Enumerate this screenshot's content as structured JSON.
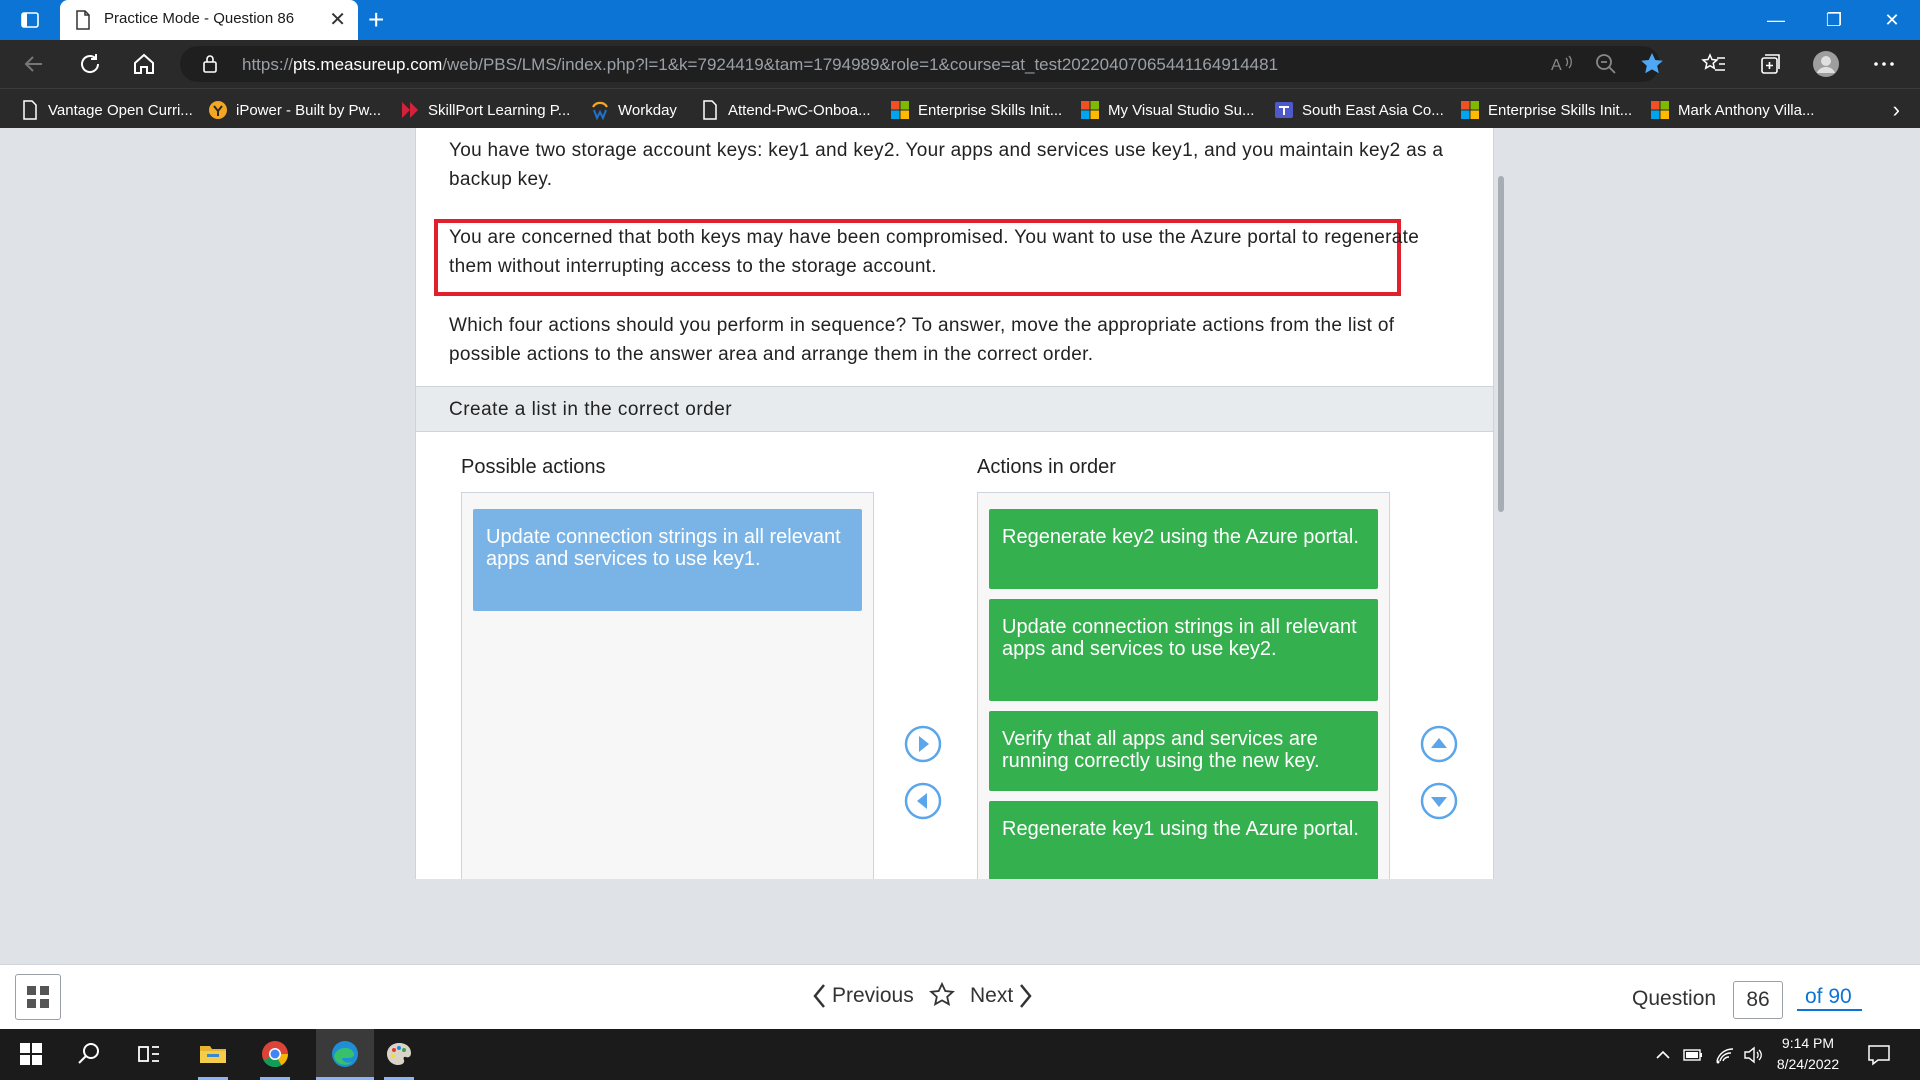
{
  "browser": {
    "tab_title": "Practice Mode - Question 86",
    "tab_close": "✕",
    "new_tab": "+",
    "window_controls": {
      "minimize": "—",
      "restore": "❐",
      "close": "✕"
    },
    "url_domain": "pts.measureup.com",
    "url_prefix": "https://",
    "url_path": "/web/PBS/LMS/index.php?l=1&k=7924419&tam=1794989&role=1&course=at_test20220407065441164914481",
    "favorites": [
      {
        "label": "Vantage Open Curri...",
        "icon": "page-icon"
      },
      {
        "label": "iPower - Built by Pw...",
        "icon": "ipower-icon"
      },
      {
        "label": "SkillPort Learning P...",
        "icon": "skillport-icon"
      },
      {
        "label": "Workday",
        "icon": "workday-icon"
      },
      {
        "label": "Attend-PwC-Onboa...",
        "icon": "page-icon"
      },
      {
        "label": "Enterprise Skills Init...",
        "icon": "microsoft-icon"
      },
      {
        "label": "My Visual Studio Su...",
        "icon": "microsoft-icon"
      },
      {
        "label": "South East Asia Co...",
        "icon": "teams-icon"
      },
      {
        "label": "Enterprise Skills Init...",
        "icon": "microsoft-icon"
      },
      {
        "label": "Mark Anthony Villa...",
        "icon": "microsoft-icon"
      }
    ],
    "favorites_more": "›"
  },
  "question": {
    "para1": "You have two storage account keys: key1 and key2. Your apps and services use key1, and you maintain key2 as a backup key.",
    "para2": "You are concerned that both keys may have been compromised. You want to use the Azure portal to regenerate them without interrupting access to the storage account.",
    "para3": "Which four actions should you perform in sequence? To answer, move the appropriate actions from the list of possible actions to the answer area and arrange them in the correct order.",
    "section_title": "Create a list in the correct order",
    "possible_title": "Possible actions",
    "order_title": "Actions in order",
    "possible_actions": [
      "Update connection strings in all relevant apps and services to use key1."
    ],
    "ordered_actions": [
      "Regenerate key2 using the Azure portal.",
      "Update connection strings in all relevant apps and services to use key2.",
      "Verify that all apps and services are running correctly using the new key.",
      "Regenerate key1 using the Azure portal."
    ]
  },
  "footer": {
    "previous_label": "Previous",
    "next_label": "Next",
    "question_label": "Question",
    "question_number": "86",
    "question_total": "of 90"
  },
  "taskbar": {
    "time": "9:14 PM",
    "date": "8/24/2022"
  },
  "colors": {
    "accent": "#0c74d4",
    "highlight_border": "#e0202c",
    "possible_item": "#7ab4e6",
    "ordered_item": "#35b04f"
  }
}
